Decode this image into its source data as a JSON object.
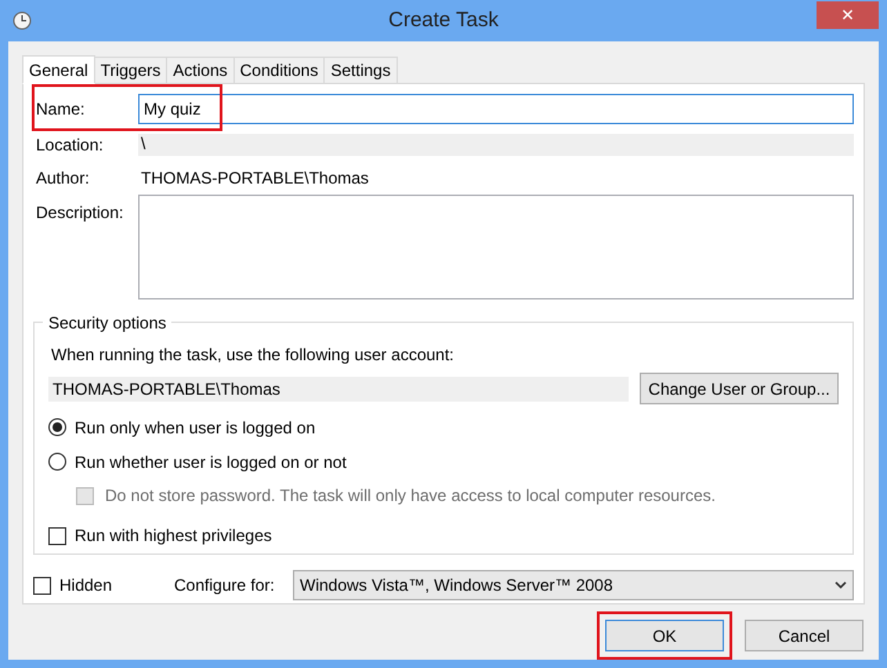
{
  "window": {
    "title": "Create Task",
    "close": "✕"
  },
  "tabs": [
    {
      "label": "General",
      "selected": true
    },
    {
      "label": "Triggers",
      "selected": false
    },
    {
      "label": "Actions",
      "selected": false
    },
    {
      "label": "Conditions",
      "selected": false
    },
    {
      "label": "Settings",
      "selected": false
    }
  ],
  "general": {
    "name": {
      "label": "Name:",
      "value": "My quiz",
      "highlighted": true
    },
    "location": {
      "label": "Location:",
      "value": "\\"
    },
    "author": {
      "label": "Author:",
      "value": "THOMAS-PORTABLE\\Thomas"
    },
    "description": {
      "label": "Description:"
    }
  },
  "security": {
    "title": "Security options",
    "account_prompt": "When running the task, use the following user account:",
    "account": "THOMAS-PORTABLE\\Thomas",
    "change_button": "Change User or Group...",
    "options": [
      {
        "kind": "radio",
        "label": "Run only when user is logged on",
        "selected": true
      },
      {
        "kind": "radio",
        "label": "Run whether user is logged on or not",
        "selected": false
      },
      {
        "kind": "sub_checkbox",
        "label": "Do not store password.  The task will only have access to local computer resources.",
        "checked": false,
        "disabled": true
      },
      {
        "kind": "checkbox",
        "label": "Run with highest privileges",
        "checked": false,
        "disabled": false
      }
    ]
  },
  "hidden": {
    "label": "Hidden",
    "checked": false
  },
  "configure": {
    "label": "Configure for:",
    "value": "Windows Vista™, Windows Server™ 2008"
  },
  "buttons": [
    {
      "label": "OK",
      "highlighted": true,
      "default": true
    },
    {
      "label": "Cancel",
      "highlighted": false,
      "default": false
    }
  ]
}
